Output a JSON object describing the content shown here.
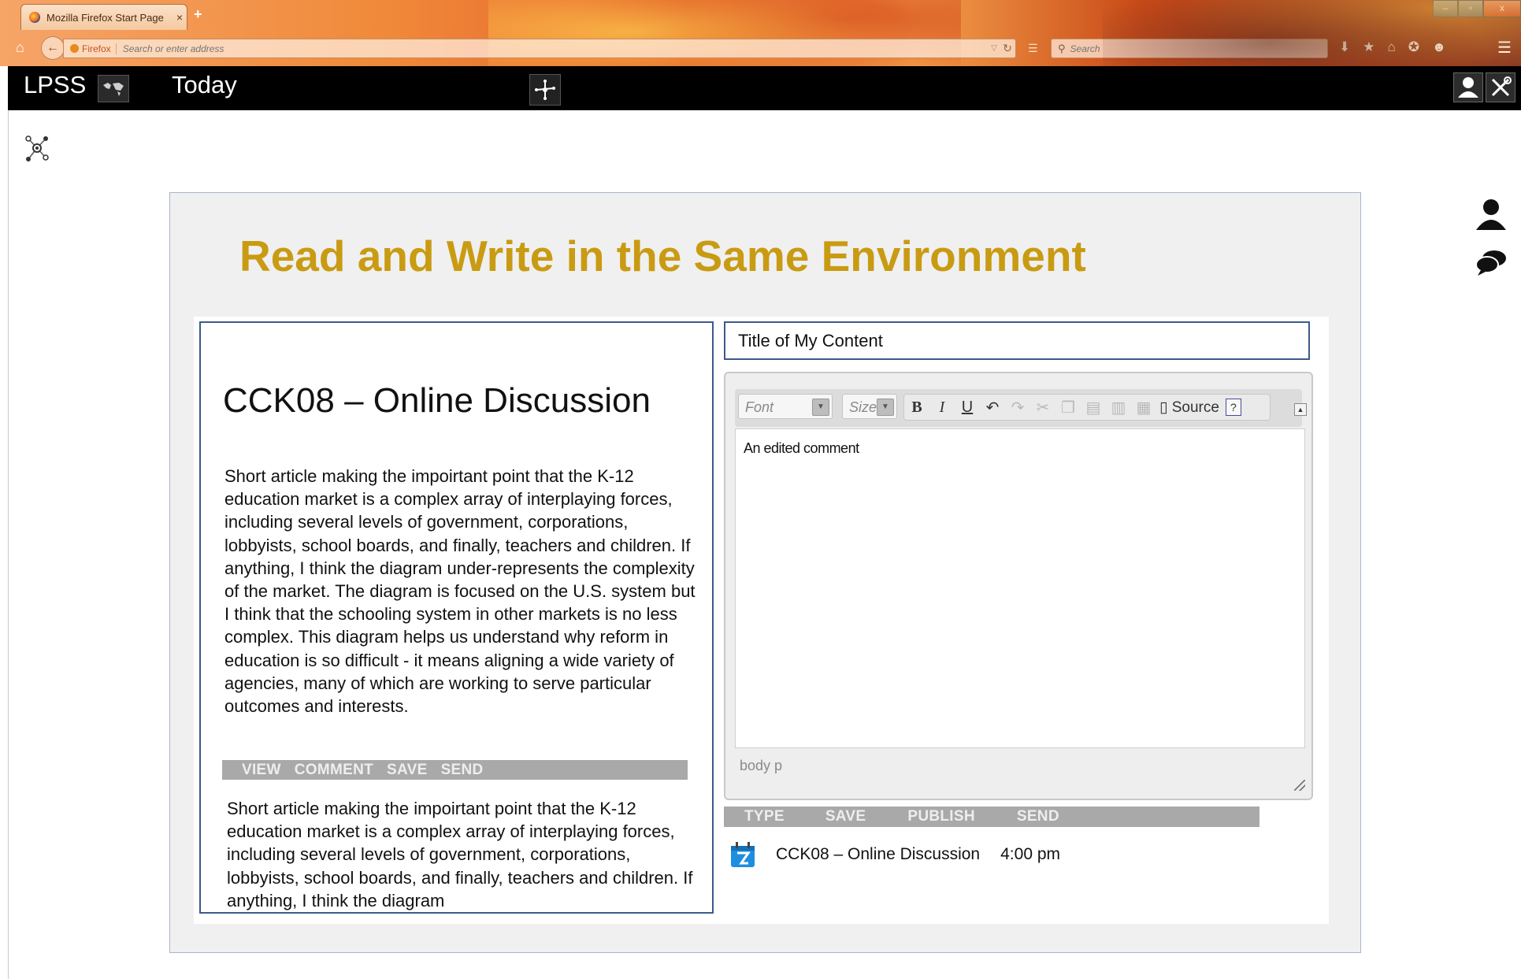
{
  "browser": {
    "tab_title": "Mozilla Firefox Start Page",
    "tab_close": "×",
    "new_tab": "+",
    "identity_label": "Firefox",
    "url_placeholder": "Search or enter address",
    "search_placeholder": "Search",
    "window_controls": {
      "minimize": "–",
      "restore": "▫",
      "close": "x"
    }
  },
  "app": {
    "logo": "LPSS",
    "section": "Today"
  },
  "slide": {
    "title": "Read and Write in the Same Environment"
  },
  "read_pane": {
    "article_title": "CCK08 – Online Discussion",
    "article_body_1": "Short article making  the impoirtant point that the K-12 education market is a complex  array of interplaying forces, including several levels of government, corporations, lobbyists, school boards, and finally, teachers and children. If anything, I think the diagram under-represents the complexity  of the market.  The diagram is focused on the U.S.  system but I think that the schooling system in other markets is no less complex.  This diagram helps us understand why reform in education is so difficult - it means aligning a wide variety of agencies, many of which  are working to serve particular outcomes and interests.",
    "article_body_2": "Short article making  the impoirtant point that the K-12 education market is a complex  array of interplaying forces, including several levels of government, corporations, lobbyists, school boards, and finally, teachers and children. If anything, I think the diagram",
    "actions": [
      "VIEW",
      "COMMENT",
      "SAVE",
      "SEND"
    ]
  },
  "write_pane": {
    "content_title": "Title of My Content",
    "toolbar": {
      "font_label": "Font",
      "size_label": "Size",
      "source_label": "Source",
      "help_label": "?"
    },
    "editor_text": "An edited comment",
    "status_path": "body  p",
    "actions": [
      "TYPE",
      "SAVE",
      "PUBLISH",
      "SEND"
    ],
    "post": {
      "title": "CCK08  – Online  Discussion",
      "time": "4:00 pm"
    }
  },
  "colors": {
    "title_gold": "#c99b12",
    "pane_border": "#3d5a8a",
    "action_bar": "#a9a9a9"
  }
}
